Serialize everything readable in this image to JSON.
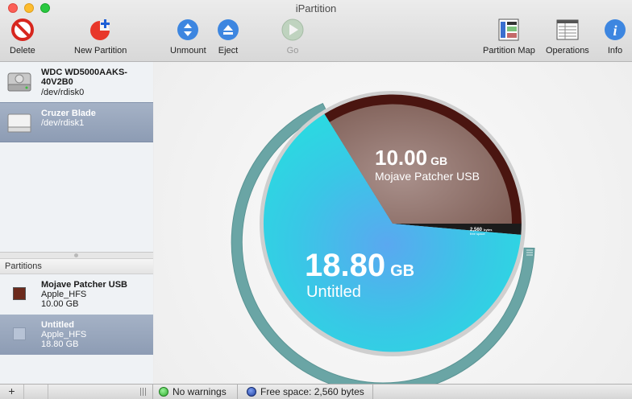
{
  "window": {
    "title": "iPartition"
  },
  "toolbar": {
    "delete": "Delete",
    "new_partition": "New Partition",
    "unmount": "Unmount",
    "eject": "Eject",
    "go": "Go",
    "partition_map": "Partition Map",
    "operations": "Operations",
    "info": "Info"
  },
  "disks": [
    {
      "name": "WDC WD5000AAKS-40V2B0",
      "device": "/dev/rdisk0",
      "icon": "hard-drive-icon"
    },
    {
      "name": "Cruzer Blade",
      "device": "/dev/rdisk1",
      "icon": "usb-drive-icon",
      "selected": true
    }
  ],
  "partitions_header": "Partitions",
  "partitions": [
    {
      "name": "Mojave Patcher USB",
      "format": "Apple_HFS",
      "size": "10.00 GB",
      "color": "#6b2a1c"
    },
    {
      "name": "Untitled",
      "format": "Apple_HFS",
      "size": "18.80 GB",
      "color": "#b7c3d6",
      "selected": true
    }
  ],
  "chart": {
    "mojave_value": "10.00",
    "mojave_unit": "GB",
    "mojave_name": "Mojave Patcher USB",
    "untitled_value": "18.80",
    "untitled_unit": "GB",
    "untitled_name": "Untitled",
    "free_value": "2,560",
    "free_unit": "bytes",
    "free_name": "free space",
    "colors": {
      "untitled": "#2fd6dc",
      "mojave": "#8c6a64",
      "mojave_dark": "#4a1510",
      "ring": "#6aa5a5"
    }
  },
  "chart_data": {
    "type": "pie",
    "categories": [
      "Mojave Patcher USB",
      "Untitled",
      "free space"
    ],
    "values": [
      10.0,
      18.8,
      2.4e-06
    ],
    "units": [
      "GB",
      "GB",
      "GB"
    ]
  },
  "status": {
    "add": "+",
    "warnings": "No warnings",
    "warnings_color": "#3bbf3b",
    "free_space": "Free space: 2,560 bytes",
    "free_color": "#2a4fb5"
  }
}
